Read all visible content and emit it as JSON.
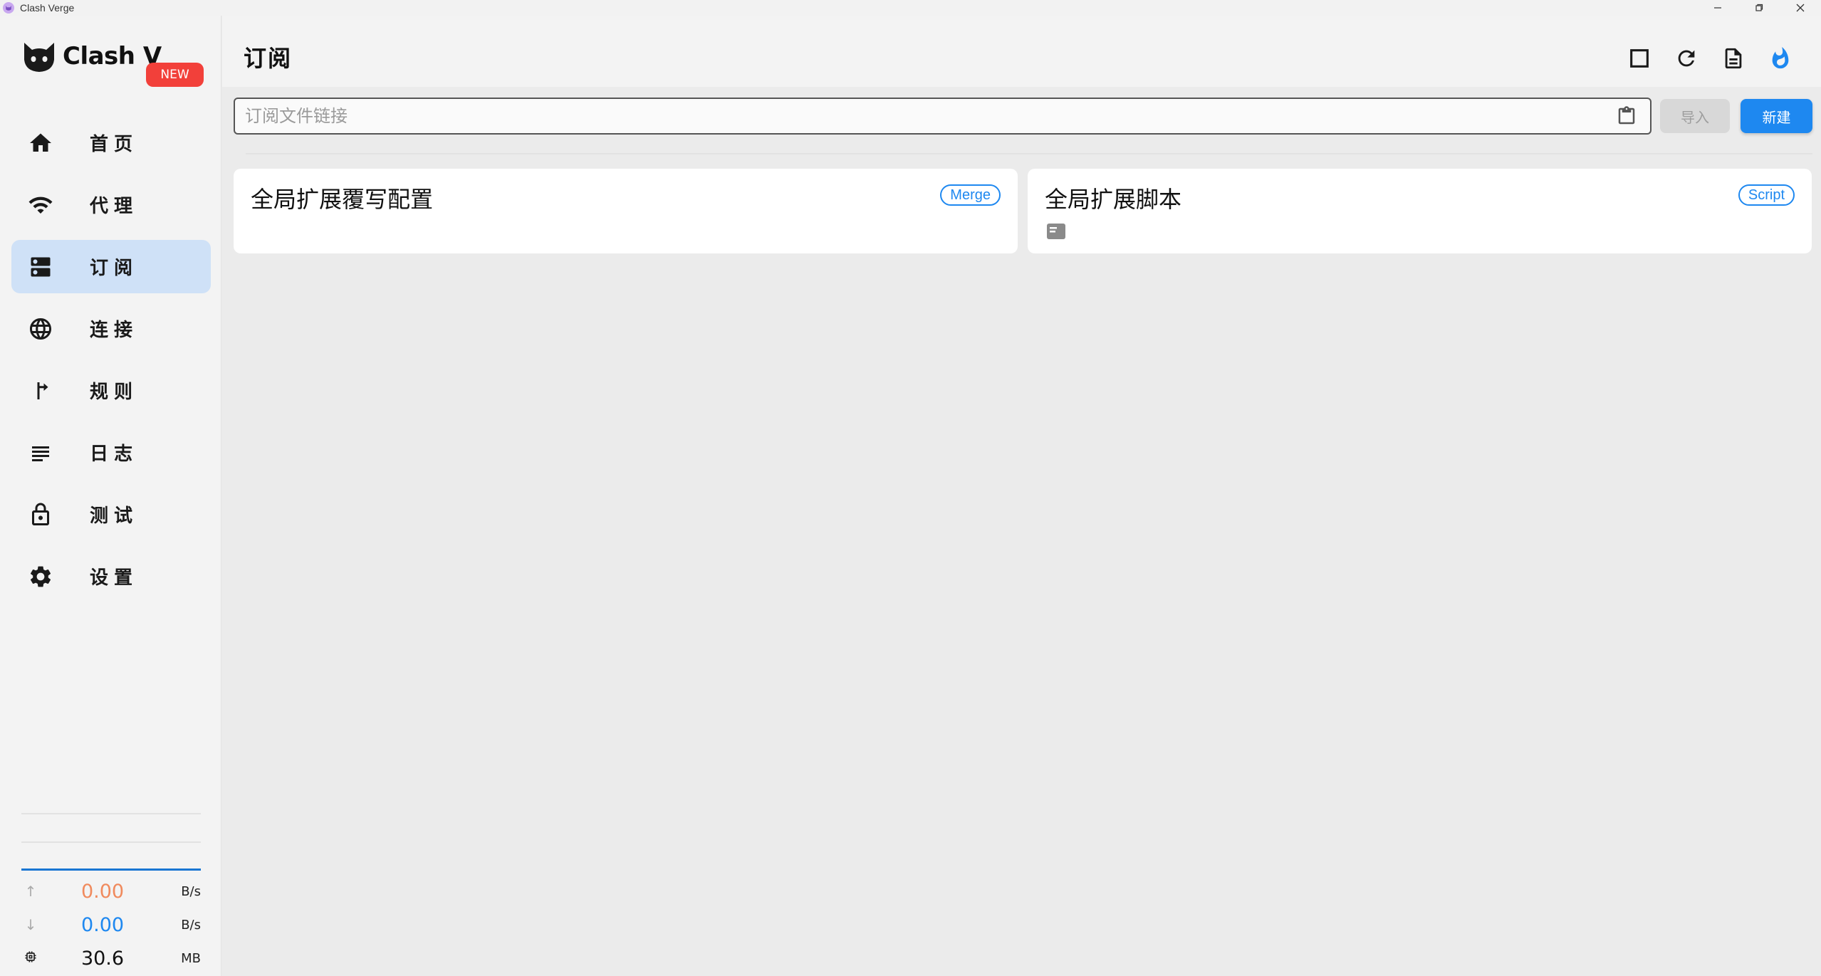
{
  "window": {
    "title": "Clash Verge",
    "minimize_icon": "minimize-icon",
    "maximize_icon": "restore-icon",
    "close_icon": "close-icon"
  },
  "brand": {
    "name": "Clash V",
    "badge": "NEW",
    "logo_icon": "cat-logo-icon",
    "badge_color": "#f2403a"
  },
  "sidebar": {
    "items": [
      {
        "label": "首页",
        "icon": "home-icon"
      },
      {
        "label": "代理",
        "icon": "wifi-icon"
      },
      {
        "label": "订阅",
        "icon": "dns-icon",
        "active": true
      },
      {
        "label": "连接",
        "icon": "globe-icon"
      },
      {
        "label": "规则",
        "icon": "fork-right-icon"
      },
      {
        "label": "日志",
        "icon": "lines-icon"
      },
      {
        "label": "测试",
        "icon": "lock-icon"
      },
      {
        "label": "设置",
        "icon": "gear-icon"
      }
    ],
    "active_color": "#cfe1f7"
  },
  "traffic": {
    "upload": {
      "value": "0.00",
      "unit": "B/s",
      "icon": "arrow-up-icon",
      "color": "#f08a5d"
    },
    "download": {
      "value": "0.00",
      "unit": "B/s",
      "icon": "arrow-down-icon",
      "color": "#1e88f0"
    },
    "memory": {
      "value": "30.6",
      "unit": "MB",
      "icon": "memory-icon"
    }
  },
  "header": {
    "title": "订阅",
    "icons": [
      "stop-square-icon",
      "refresh-icon",
      "document-icon",
      "flame-icon"
    ]
  },
  "toolbar": {
    "url_placeholder": "订阅文件链接",
    "url_value": "",
    "import_label": "导入",
    "new_label": "新建",
    "accent": "#1e88f0"
  },
  "profiles": [
    {
      "title": "全局扩展覆写配置",
      "tag": "Merge"
    },
    {
      "title": "全局扩展脚本",
      "tag": "Script",
      "icon": "file-icon"
    }
  ]
}
